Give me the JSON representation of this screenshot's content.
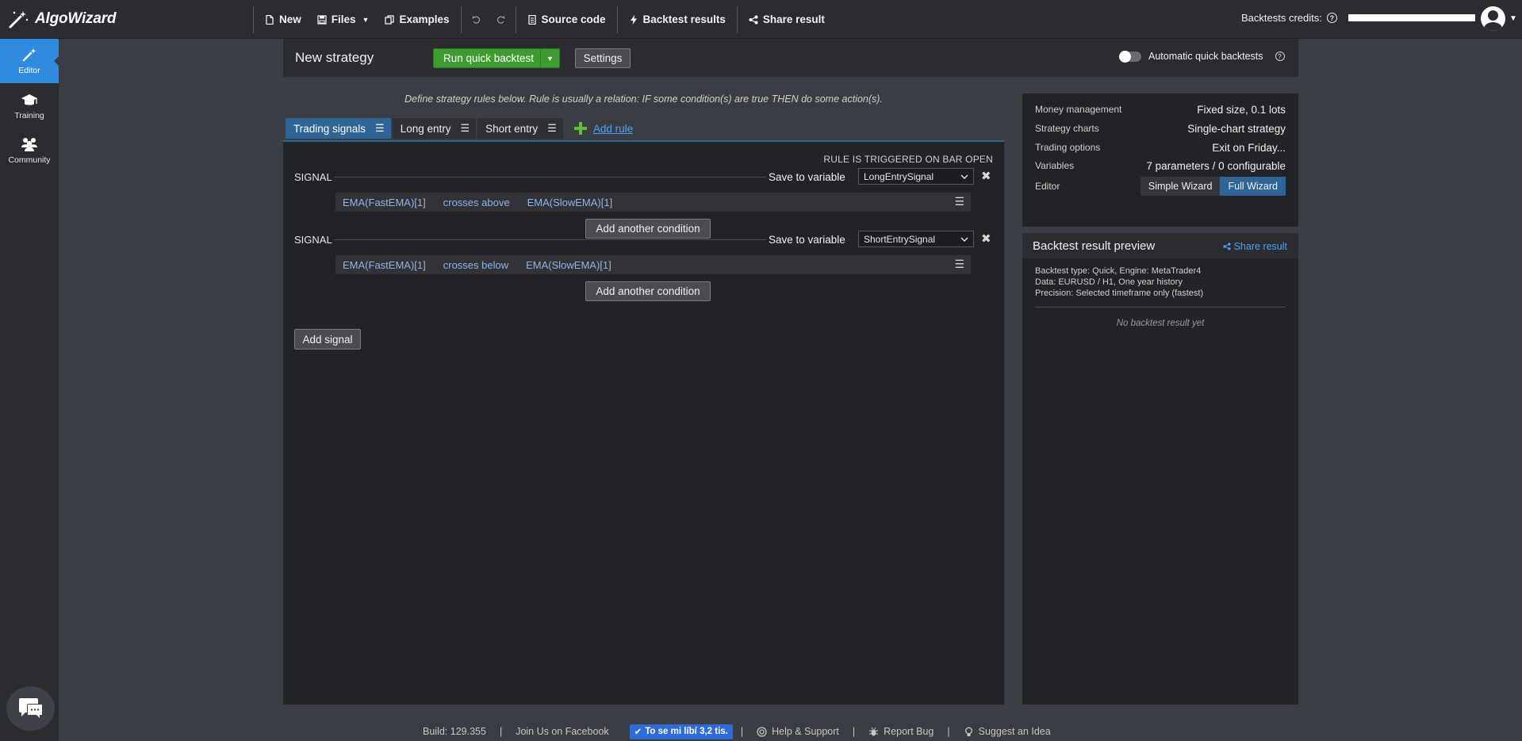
{
  "app": {
    "logo_text": "AlgoWizard"
  },
  "toolbar": {
    "new_label": "New",
    "files_label": "Files",
    "examples_label": "Examples",
    "source_code_label": "Source code",
    "backtest_results_label": "Backtest results",
    "share_result_label": "Share result"
  },
  "credits": {
    "label": "Backtests credits:",
    "help": "?"
  },
  "sidebar": {
    "items": [
      {
        "label": "Editor"
      },
      {
        "label": "Training"
      },
      {
        "label": "Community"
      }
    ]
  },
  "header": {
    "title": "New strategy",
    "run_label": "Run quick backtest",
    "settings_label": "Settings",
    "auto_label": "Automatic quick backtests",
    "auto_help": "?",
    "auto_enabled": false
  },
  "rules": {
    "hint": "Define strategy rules below. Rule is usually a relation: IF some condition(s) are true THEN do some action(s).",
    "tabs": [
      {
        "label": "Trading signals",
        "menu": "☰",
        "active": true
      },
      {
        "label": "Long entry",
        "menu": "☰",
        "active": false
      },
      {
        "label": "Short entry",
        "menu": "☰",
        "active": false
      }
    ],
    "add_rule_label": "Add rule",
    "trigger_text": "RULE IS TRIGGERED ON BAR OPEN",
    "signals": [
      {
        "label": "SIGNAL",
        "save_label": "Save to variable",
        "variable": "LongEntrySignal",
        "close": "✖",
        "condition": {
          "left": "EMA(FastEMA)[1]",
          "operator": "crosses above",
          "right": "EMA(SlowEMA)[1]",
          "menu": "☰"
        },
        "add_condition_label": "Add another condition"
      },
      {
        "label": "SIGNAL",
        "save_label": "Save to variable",
        "variable": "ShortEntrySignal",
        "close": "✖",
        "condition": {
          "left": "EMA(FastEMA)[1]",
          "operator": "crosses below",
          "right": "EMA(SlowEMA)[1]",
          "menu": "☰"
        },
        "add_condition_label": "Add another condition"
      }
    ],
    "add_signal_label": "Add signal"
  },
  "properties": {
    "rows": [
      {
        "key": "Money management",
        "value": "Fixed size, 0.1 lots"
      },
      {
        "key": "Strategy charts",
        "value": "Single-chart strategy"
      },
      {
        "key": "Trading options",
        "value": "Exit on Friday..."
      },
      {
        "key": "Variables",
        "value": "7 parameters / 0 configurable"
      }
    ],
    "editor_key": "Editor",
    "editor_options": [
      "Simple Wizard",
      "Full Wizard"
    ],
    "editor_selected": "Full Wizard"
  },
  "preview": {
    "title": "Backtest result preview",
    "share_label": "Share result",
    "lines": [
      "Backtest type: Quick, Engine: MetaTrader4",
      "Data: EURUSD / H1, One year history",
      "Precision: Selected timeframe only (fastest)"
    ],
    "empty_text": "No backtest result yet"
  },
  "footer": {
    "build": "Build: 129.355",
    "facebook": "Join Us on Facebook",
    "like_label": "To se mi líbí 3,2 tis.",
    "help": "Help & Support",
    "bug": "Report Bug",
    "idea": "Suggest an Idea",
    "pipe": "|"
  },
  "colors": {
    "accent_blue": "#2f8be0",
    "tab_active": "#2f6496",
    "run_green": "#3e9b2f",
    "link_blue": "#4aa3ff",
    "condition_text": "#8fb4e8"
  }
}
